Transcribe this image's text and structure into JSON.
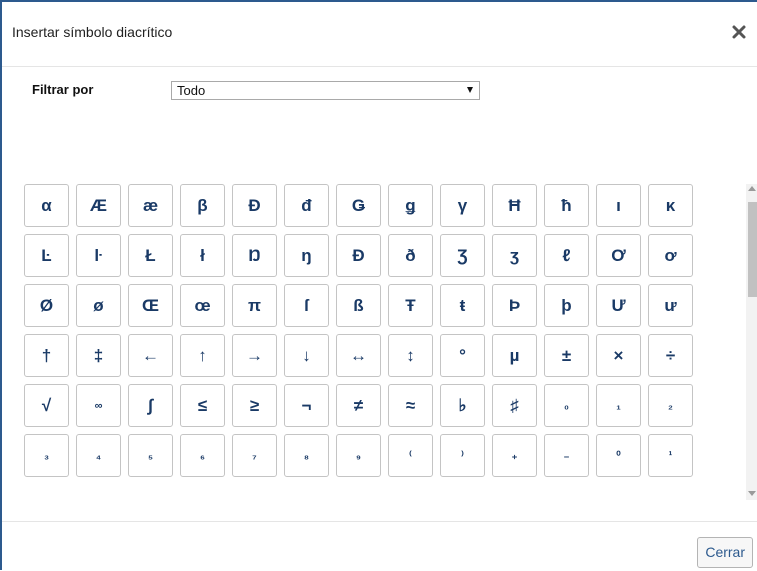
{
  "dialog": {
    "title": "Insertar símbolo diacrítico",
    "close_icon": "close-x-icon"
  },
  "filter": {
    "label": "Filtrar por",
    "selected": "Todo"
  },
  "symbols": [
    "α",
    "Æ",
    "æ",
    "β",
    "Ð",
    "đ",
    "Ǥ",
    "ǥ",
    "γ",
    "Ħ",
    "ħ",
    "ı",
    "κ",
    "Ŀ",
    "ŀ",
    "Ł",
    "ł",
    "Ŋ",
    "ŋ",
    "Ð",
    "ð",
    "Ʒ",
    "ʒ",
    "ℓ",
    "Ơ",
    "ơ",
    "Ø",
    "ø",
    "Œ",
    "œ",
    "π",
    "ſ",
    "ß",
    "Ŧ",
    "ŧ",
    "Þ",
    "þ",
    "Ư",
    "ư",
    "†",
    "‡",
    "←",
    "↑",
    "→",
    "↓",
    "↔",
    "↕",
    "°",
    "µ",
    "±",
    "×",
    "÷",
    "√",
    "∞",
    "∫",
    "≤",
    "≥",
    "¬",
    "≠",
    "≈",
    "♭",
    "♯",
    "₀",
    "₁",
    "₂",
    "₃",
    "₄",
    "₅",
    "₆",
    "₇",
    "₈",
    "₉",
    "⁽",
    "⁾",
    "₊",
    "₋",
    "⁰",
    "¹"
  ],
  "footer": {
    "close_label": "Cerrar"
  },
  "colors": {
    "accent": "#2d5a8e",
    "symbol_text": "#1a3a66"
  }
}
